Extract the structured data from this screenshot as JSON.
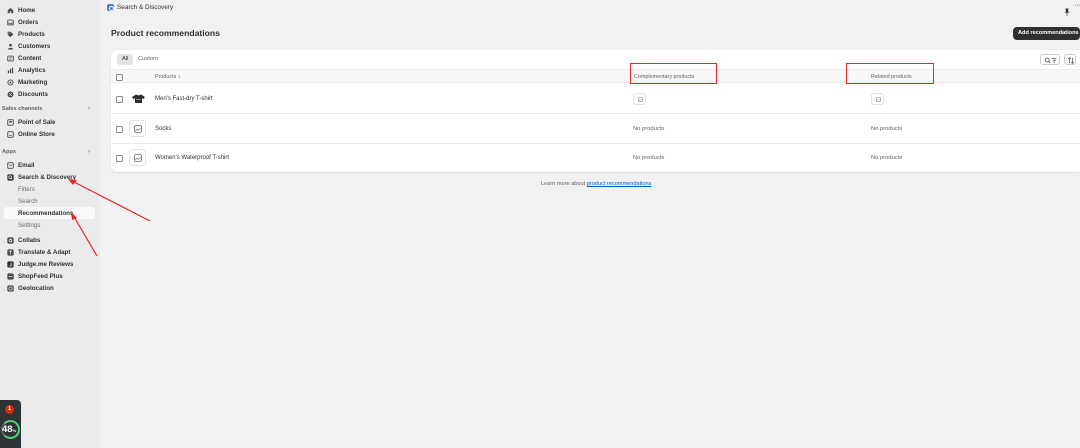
{
  "sidebar": {
    "main_items": [
      {
        "label": "Home",
        "icon": "home-icon"
      },
      {
        "label": "Orders",
        "icon": "inbox-icon"
      },
      {
        "label": "Products",
        "icon": "tag-icon"
      },
      {
        "label": "Customers",
        "icon": "person-icon"
      },
      {
        "label": "Content",
        "icon": "content-icon"
      },
      {
        "label": "Analytics",
        "icon": "chart-icon"
      },
      {
        "label": "Marketing",
        "icon": "target-icon"
      },
      {
        "label": "Discounts",
        "icon": "discount-icon"
      }
    ],
    "sales_channels_label": "Sales channels",
    "sales_channels": [
      {
        "label": "Point of Sale",
        "icon": "pos-icon"
      },
      {
        "label": "Online Store",
        "icon": "store-icon"
      }
    ],
    "apps_label": "Apps",
    "apps": {
      "email": "Email",
      "search_discovery": "Search & Discovery",
      "sub_items": [
        "Filters",
        "Search",
        "Recommendations",
        "Settings"
      ],
      "others": [
        "Collabs",
        "Translate & Adapt",
        "Judge.me Reviews",
        "ShopFeed Plus",
        "Geolocation"
      ]
    }
  },
  "widget": {
    "badge": "1",
    "percent": "48",
    "percent_unit": "%"
  },
  "topbar": {
    "app_title": "Search & Discovery",
    "more": "···"
  },
  "page": {
    "title": "Product recommendations",
    "add_button": "Add recommendations",
    "tabs": [
      "All",
      "Custom"
    ],
    "columns": {
      "products": "Products",
      "sort_glyph": "↕",
      "complementary": "Complementary products",
      "related": "Related products"
    },
    "rows": [
      {
        "name": "Men's Fast-dry T-shirt",
        "complementary": "",
        "related": ""
      },
      {
        "name": "Socks",
        "complementary": "No products",
        "related": "No products"
      },
      {
        "name": "Women's Waterproof T-shirt",
        "complementary": "No products",
        "related": "No products"
      }
    ],
    "learn_prefix": "Learn more about ",
    "learn_link": "product recommendations"
  },
  "colors": {
    "annotation": "#e3262a",
    "link": "#005bd3",
    "primary_button": "#303030"
  }
}
